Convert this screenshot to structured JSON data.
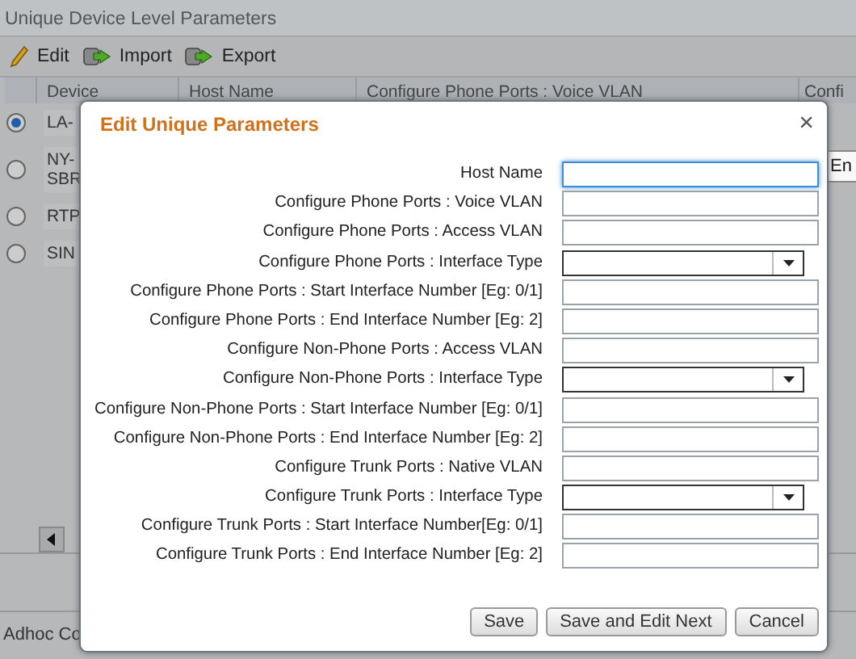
{
  "panel": {
    "title": "Unique Device Level Parameters"
  },
  "toolbar": [
    {
      "label": "Edit",
      "kind": "edit"
    },
    {
      "label": "Import",
      "kind": "import"
    },
    {
      "label": "Export",
      "kind": "export"
    }
  ],
  "table": {
    "columns": [
      "Device",
      "Host Name",
      "Configure Phone Ports : Voice VLAN",
      "Confi"
    ],
    "rows": [
      {
        "device": [
          "LA-"
        ],
        "selected": true
      },
      {
        "device": [
          "NY-",
          "SBR"
        ],
        "selected": false
      },
      {
        "device": [
          "RTP"
        ],
        "selected": false
      },
      {
        "device": [
          "SIN"
        ],
        "selected": false
      }
    ]
  },
  "footer": {
    "label": "Adhoc Co"
  },
  "tooltip": {
    "text": "En"
  },
  "dialog": {
    "title": "Edit Unique Parameters",
    "close": "×",
    "fields": [
      {
        "label": "Host Name",
        "kind": "text",
        "focused": true
      },
      {
        "label": "Configure Phone Ports : Voice VLAN",
        "kind": "text",
        "focused": false
      },
      {
        "label": "Configure Phone Ports : Access VLAN",
        "kind": "text",
        "focused": false
      },
      {
        "label": "Configure Phone Ports : Interface Type",
        "kind": "select",
        "focused": false
      },
      {
        "label": "Configure Phone Ports : Start Interface Number [Eg: 0/1]",
        "kind": "text",
        "focused": false
      },
      {
        "label": "Configure Phone Ports : End Interface Number [Eg: 2]",
        "kind": "text",
        "focused": false
      },
      {
        "label": "Configure Non-Phone Ports : Access VLAN",
        "kind": "text",
        "focused": false
      },
      {
        "label": "Configure Non-Phone Ports : Interface Type",
        "kind": "select",
        "focused": false
      },
      {
        "label": "Configure Non-Phone Ports : Start Interface Number [Eg: 0/1]",
        "kind": "text",
        "focused": false
      },
      {
        "label": "Configure Non-Phone Ports : End Interface Number [Eg: 2]",
        "kind": "text",
        "focused": false
      },
      {
        "label": "Configure Trunk Ports : Native VLAN",
        "kind": "text",
        "focused": false
      },
      {
        "label": "Configure Trunk Ports : Interface Type",
        "kind": "select",
        "focused": false
      },
      {
        "label": "Configure Trunk Ports : Start Interface Number[Eg: 0/1]",
        "kind": "text",
        "focused": false
      },
      {
        "label": "Configure Trunk Ports : End Interface Number [Eg: 2]",
        "kind": "text",
        "focused": false
      }
    ],
    "buttons": [
      "Save",
      "Save and Edit Next",
      "Cancel"
    ]
  }
}
